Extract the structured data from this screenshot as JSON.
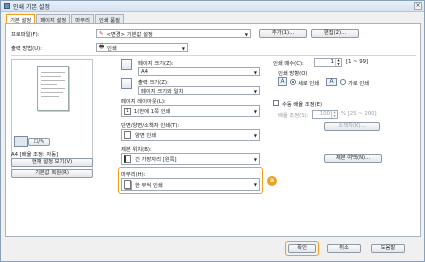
{
  "window": {
    "title": "인쇄 기본 설정"
  },
  "tabs": [
    "기본 설정",
    "페이지 설정",
    "마무리",
    "인쇄 품질"
  ],
  "profile": {
    "label": "프로파일(F):",
    "value": "<변경> 기본값 설정",
    "add": "추가(1)...",
    "edit": "편집(2)..."
  },
  "output": {
    "label": "출력 방법(U):",
    "value": "인쇄"
  },
  "preview": {
    "mode": "A4 [배율 조정: 자동]",
    "view_settings": "현재 설정 보기(V)",
    "restore": "기본값 복원(R)"
  },
  "page_size": {
    "label": "페이지 크기(Z):",
    "value": "A4"
  },
  "output_size": {
    "label": "출력 크기(Z):",
    "value": "페이지 크기와 일치"
  },
  "page_layout": {
    "label": "페이지 레이아웃(L):",
    "value": "1(한에 1쪽 인쇄"
  },
  "duplex": {
    "label": "단면/양면/소책자 인쇄(T):",
    "value": "양면 인쇄"
  },
  "binding": {
    "label": "제본 위치(B):",
    "value": "긴 가장자리 [왼쪽]",
    "margin_button": "제본 여백(N)..."
  },
  "finishing": {
    "label": "마무리(H):",
    "value": "한 부씩 인쇄",
    "badge": "a"
  },
  "copies": {
    "label": "인쇄 매수(C):",
    "value": "1",
    "range": "[1 ~ 99]"
  },
  "orientation": {
    "label": "인쇄 방향(O)",
    "portrait": "세로 인쇄",
    "landscape": "가로 인쇄"
  },
  "scaling": {
    "check": "수동 배율 조정(E)",
    "label": "배율 조정(S):",
    "value": "100",
    "range": "% [25 ~ 200]",
    "booklet": "소책자(K)..."
  },
  "footer": {
    "ok": "확인",
    "cancel": "취소",
    "help": "도움말"
  }
}
